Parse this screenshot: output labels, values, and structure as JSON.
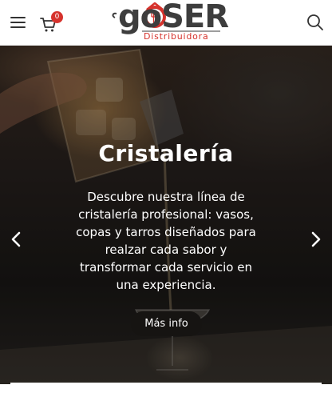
{
  "header": {
    "menu_icon": "hamburger-menu-icon",
    "cart_icon": "shopping-cart-icon",
    "cart_count": "0",
    "logo_text": "goSER",
    "logo_subtitle": "Distribuidora",
    "search_icon": "search-icon"
  },
  "hero": {
    "title": "Cristalería",
    "description": "Descubre nuestra línea de cristalería profesional: vasos, copas y tarros diseñados para realzar cada sabor y transformar cada servicio en una experiencia.",
    "button_label": "Más info",
    "prev_icon": "chevron-left-icon",
    "next_icon": "chevron-right-icon"
  },
  "colors": {
    "brand_red": "#d6322c",
    "logo_gray": "#3d3d3d",
    "button_dark": "#161412"
  }
}
